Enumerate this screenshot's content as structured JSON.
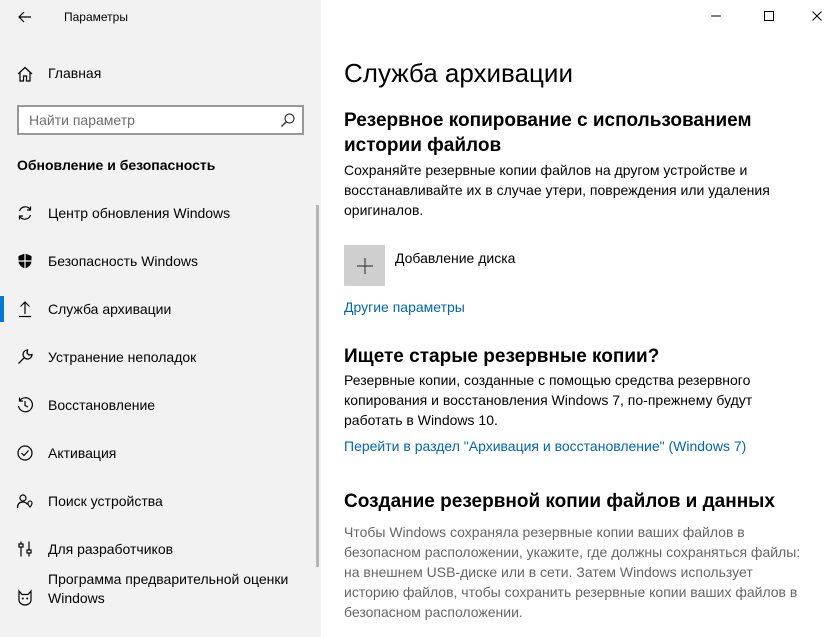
{
  "window": {
    "app_title": "Параметры"
  },
  "sidebar": {
    "home_label": "Главная",
    "search_placeholder": "Найти параметр",
    "section_title": "Обновление и безопасность",
    "items": [
      {
        "label": "Центр обновления Windows",
        "icon": "sync-icon"
      },
      {
        "label": "Безопасность Windows",
        "icon": "shield-icon"
      },
      {
        "label": "Служба архивации",
        "icon": "backup-arrow-icon",
        "active": true
      },
      {
        "label": "Устранение неполадок",
        "icon": "wrench-icon"
      },
      {
        "label": "Восстановление",
        "icon": "history-icon"
      },
      {
        "label": "Активация",
        "icon": "check-circle-icon"
      },
      {
        "label": "Поиск устройства",
        "icon": "person-pin-icon"
      },
      {
        "label": "Для разработчиков",
        "icon": "sliders-icon"
      },
      {
        "label": "Программа предварительной оценки Windows",
        "icon": "insider-cat-icon"
      }
    ]
  },
  "main": {
    "title": "Служба архивации",
    "file_history": {
      "heading": "Резервное копирование с использованием истории файлов",
      "description": "Сохраняйте резервные копии файлов на другом устройстве и восстанавливайте их в случае утери, повреждения или удаления оригиналов.",
      "add_drive_label": "Добавление диска",
      "more_options_link": "Другие параметры"
    },
    "old_backup": {
      "heading": "Ищете старые резервные копии?",
      "description": "Резервные копии, созданные с помощью средства резервного копирования и восстановления Windows 7, по-прежнему будут работать в Windows 10.",
      "link": "Перейти в раздел \"Архивация и восстановление\" (Windows 7)"
    },
    "create_backup": {
      "heading": "Создание резервной копии файлов и данных",
      "description": "Чтобы Windows сохраняла резервные копии ваших файлов в безопасном расположении, укажите, где должны сохраняться файлы: на внешнем USB-диске или в сети. Затем Windows использует историю файлов, чтобы сохранить резервные копии ваших файлов в безопасном расположении."
    }
  },
  "colors": {
    "accent": "#0078d7",
    "link": "#0066b4",
    "sidebar_bg": "#f2f2f2"
  }
}
